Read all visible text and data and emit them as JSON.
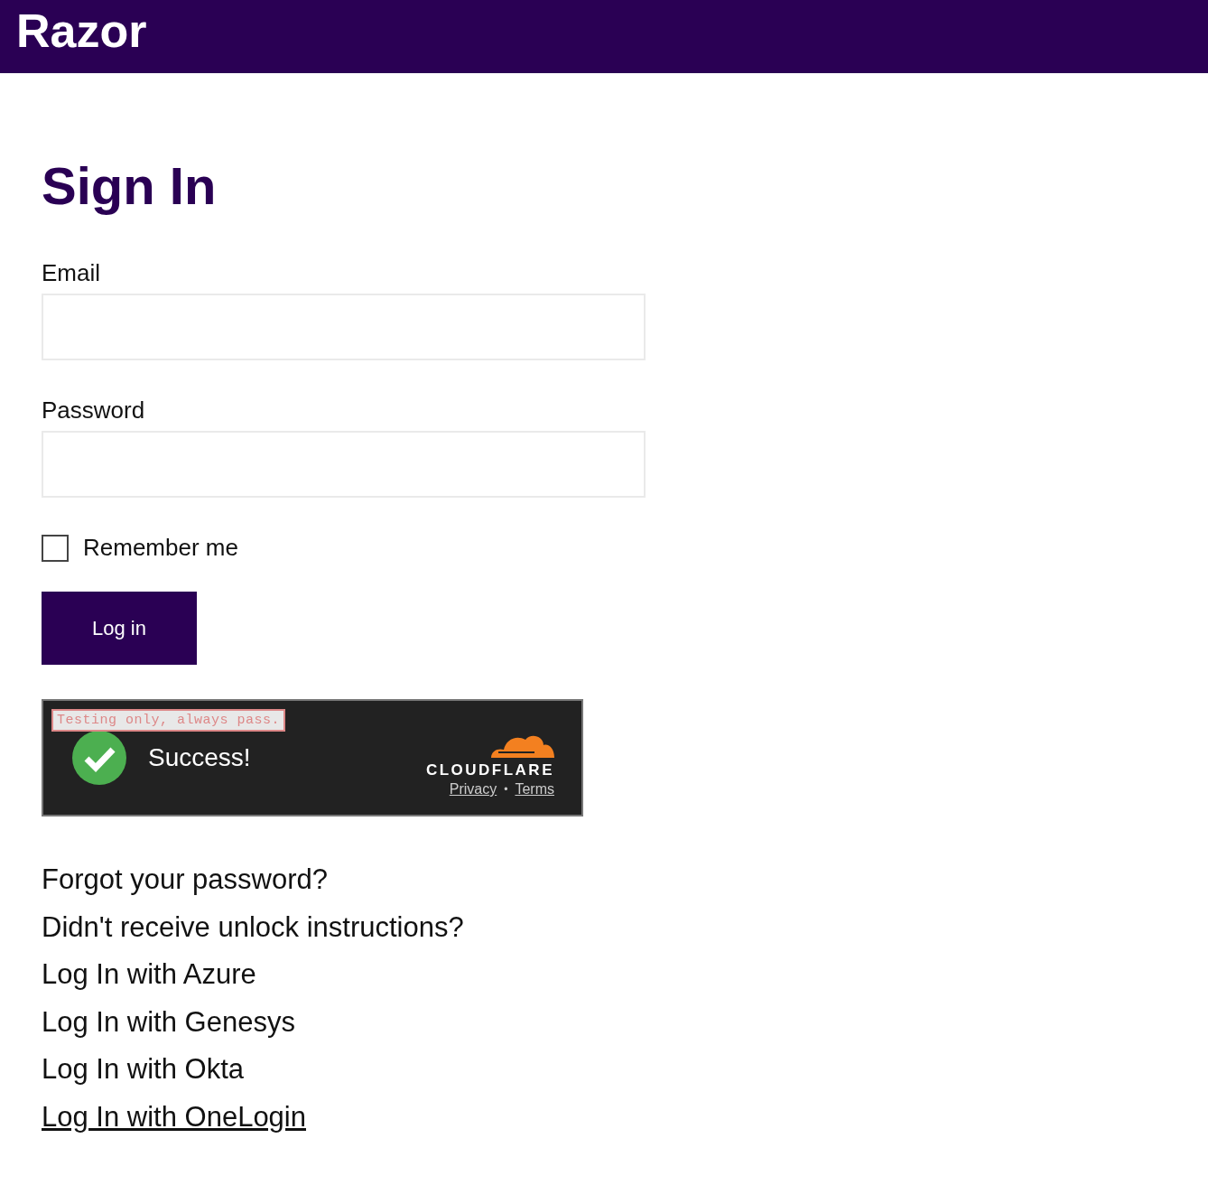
{
  "header": {
    "brand": "Razor"
  },
  "title": "Sign In",
  "fields": [
    {
      "label": "Email"
    },
    {
      "label": "Password"
    }
  ],
  "remember": {
    "label": "Remember me",
    "checked": false
  },
  "submit": "Log in",
  "captcha": {
    "notice": "Testing only, always pass.",
    "status": "Success!",
    "provider": "CLOUDFLARE",
    "links": [
      "Privacy",
      "Terms"
    ],
    "separator": "•"
  },
  "links": [
    {
      "label": "Forgot your password?",
      "hovered": false
    },
    {
      "label": "Didn't receive unlock instructions?",
      "hovered": false
    },
    {
      "label": "Log In with Azure",
      "hovered": false
    },
    {
      "label": "Log In with Genesys",
      "hovered": false
    },
    {
      "label": "Log In with Okta",
      "hovered": false
    },
    {
      "label": "Log In with OneLogin",
      "hovered": true
    }
  ]
}
